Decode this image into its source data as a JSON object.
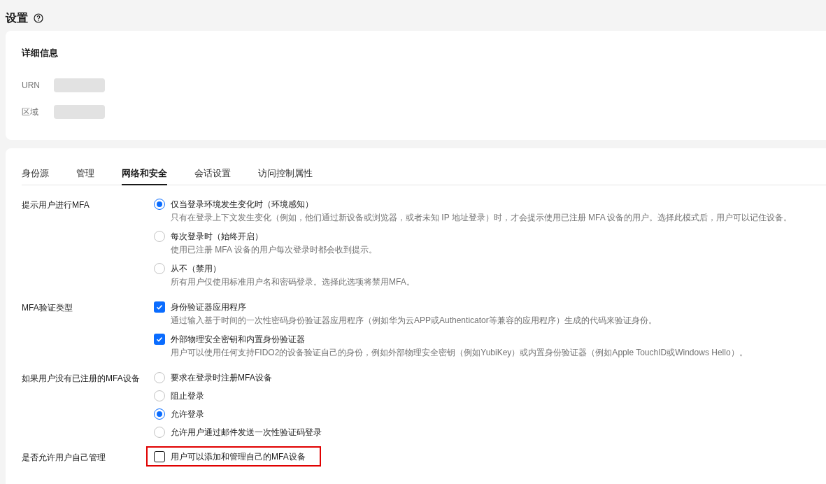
{
  "page": {
    "title": "设置"
  },
  "details": {
    "title": "详细信息",
    "fields": [
      {
        "label": "URN"
      },
      {
        "label": "区域"
      }
    ]
  },
  "tabs": [
    {
      "label": "身份源",
      "selected": false
    },
    {
      "label": "管理",
      "selected": false
    },
    {
      "label": "网络和安全",
      "selected": true
    },
    {
      "label": "会话设置",
      "selected": false
    },
    {
      "label": "访问控制属性",
      "selected": false
    }
  ],
  "sections": [
    {
      "label": "提示用户进行MFA",
      "kind": "radio",
      "options": [
        {
          "title": "仅当登录环境发生变化时（环境感知）",
          "description": "只有在登录上下文发生变化（例如，他们通过新设备或浏览器，或者未知 IP 地址登录）时，才会提示使用已注册 MFA 设备的用户。选择此模式后，用户可以记住设备。",
          "selected": true
        },
        {
          "title": "每次登录时（始终开启）",
          "description": "使用已注册 MFA 设备的用户每次登录时都会收到提示。",
          "selected": false
        },
        {
          "title": "从不（禁用）",
          "description": "所有用户仅使用标准用户名和密码登录。选择此选项将禁用MFA。",
          "selected": false
        }
      ]
    },
    {
      "label": "MFA验证类型",
      "kind": "checkbox",
      "options": [
        {
          "title": "身份验证器应用程序",
          "description": "通过输入基于时间的一次性密码身份验证器应用程序（例如华为云APP或Authenticator等兼容的应用程序）生成的代码来验证身份。",
          "checked": true
        },
        {
          "title": "外部物理安全密钥和内置身份验证器",
          "description": "用户可以使用任何支持FIDO2的设备验证自己的身份，例如外部物理安全密钥（例如YubiKey）或内置身份验证器（例如Apple TouchID或Windows Hello）。",
          "checked": true
        }
      ]
    },
    {
      "label": "如果用户没有已注册的MFA设备",
      "kind": "radio",
      "options": [
        {
          "title": "要求在登录时注册MFA设备",
          "selected": false
        },
        {
          "title": "阻止登录",
          "selected": false
        },
        {
          "title": "允许登录",
          "selected": true
        },
        {
          "title": "允许用户通过邮件发送一次性验证码登录",
          "selected": false
        }
      ]
    },
    {
      "label": "是否允许用户自己管理",
      "kind": "checkbox",
      "options": [
        {
          "title": "用户可以添加和管理自己的MFA设备",
          "checked": false,
          "highlighted": true
        }
      ]
    }
  ]
}
